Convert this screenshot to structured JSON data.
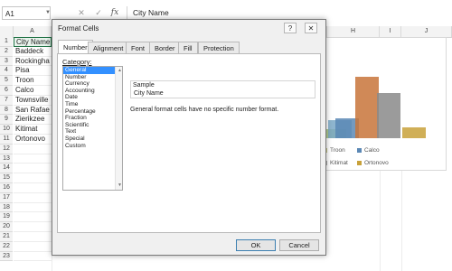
{
  "formula_bar": {
    "name_box": "A1",
    "fx_label": "fx",
    "cancel_glyph": "✕",
    "enter_glyph": "✓",
    "formula": "City Name"
  },
  "columns": [
    "A",
    "H",
    "I",
    "J"
  ],
  "rows": [
    "1",
    "2",
    "3",
    "4",
    "5",
    "6",
    "7",
    "8",
    "9",
    "10",
    "11",
    "12",
    "13",
    "14",
    "15",
    "16",
    "17",
    "18",
    "19",
    "20",
    "21",
    "22",
    "23"
  ],
  "cells_a": [
    "City Name",
    "Baddeck",
    "Rockingha",
    "Pisa",
    "Troon",
    "Calco",
    "Townsville",
    "San Rafae",
    "Zierikzee",
    "Kitimat",
    "Ortonovo"
  ],
  "chart": {
    "legend": [
      {
        "name": "Troon",
        "color": "#c7c78a"
      },
      {
        "name": "Calco",
        "color": "#5b88b5"
      },
      {
        "name": "Kitimat",
        "color": "#a9a9a9"
      },
      {
        "name": "Ortonovo",
        "color": "#c8a13a"
      }
    ],
    "bar_colors": [
      "#9ebf7a",
      "#7aa8c6",
      "#5b88b5",
      "#c8743a",
      "#8a8a8a",
      "#c8a13a"
    ]
  },
  "dialog": {
    "title": "Format Cells",
    "help_glyph": "?",
    "close_glyph": "✕",
    "tabs": [
      "Number",
      "Alignment",
      "Font",
      "Border",
      "Fill",
      "Protection"
    ],
    "category_label": "Category:",
    "categories": [
      "General",
      "Number",
      "Currency",
      "Accounting",
      "Date",
      "Time",
      "Percentage",
      "Fraction",
      "Scientific",
      "Text",
      "Special",
      "Custom"
    ],
    "selected_category": "General",
    "sample_label": "Sample",
    "sample_value": "City Name",
    "description": "General format cells have no specific number format.",
    "ok_label": "OK",
    "cancel_label": "Cancel"
  }
}
